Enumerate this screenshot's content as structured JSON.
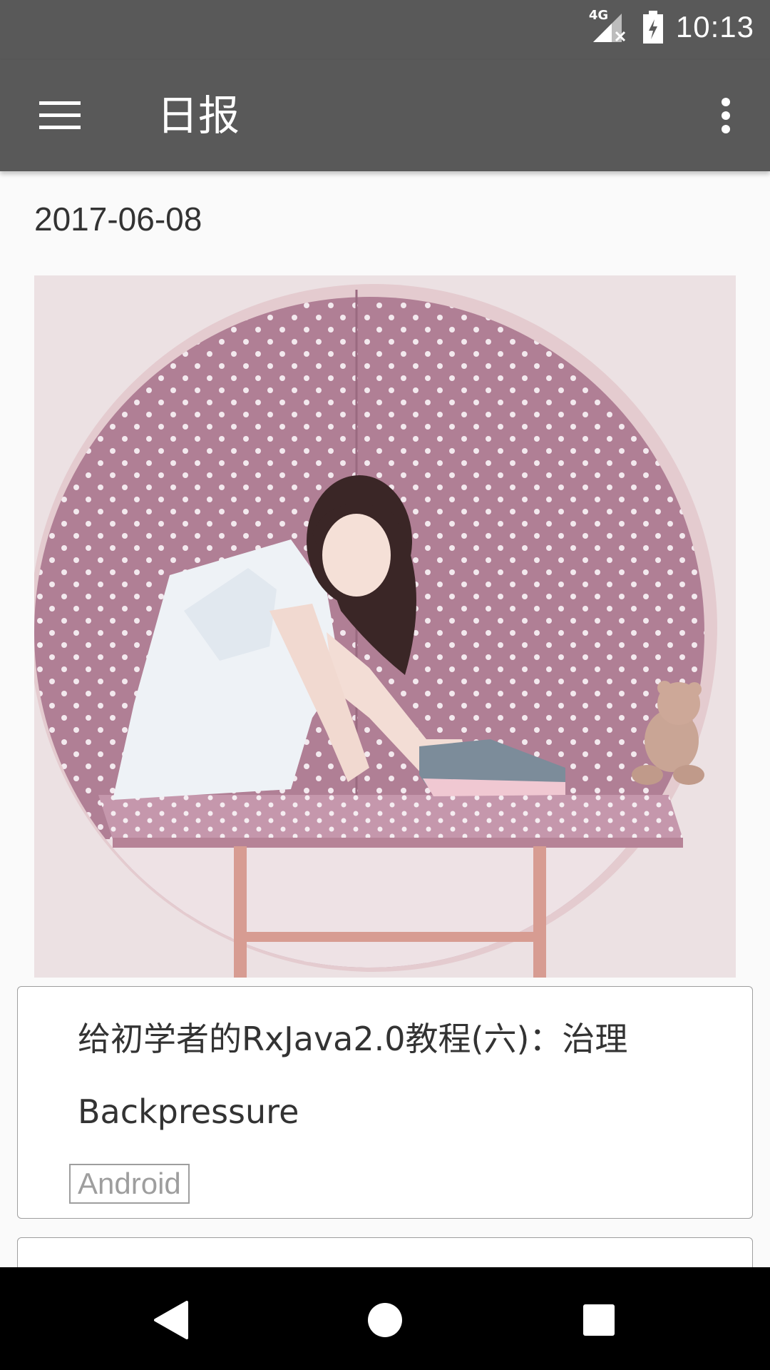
{
  "status_bar": {
    "network": "4G",
    "time": "10:13"
  },
  "app_bar": {
    "title": "日报",
    "menu_icon": "hamburger-menu-icon",
    "overflow_icon": "more-vert-icon"
  },
  "feed": {
    "date": "2017-06-08",
    "cover_image": "photo of a girl in white dress sitting on a pink polka-dot bench inside a circular alcove with a teddy bear",
    "articles": [
      {
        "title": "给初学者的RxJava2.0教程(六)：治理Backpressure",
        "tag": "Android"
      },
      {
        "title": "",
        "tag": ""
      }
    ]
  },
  "nav_bar": {
    "back_icon": "back-triangle-icon",
    "home_icon": "home-circle-icon",
    "recents_icon": "recents-square-icon"
  },
  "colors": {
    "app_bar": "#595959",
    "background": "#fafafa",
    "card_border": "#9e9e9e",
    "nav_bar": "#000000"
  }
}
